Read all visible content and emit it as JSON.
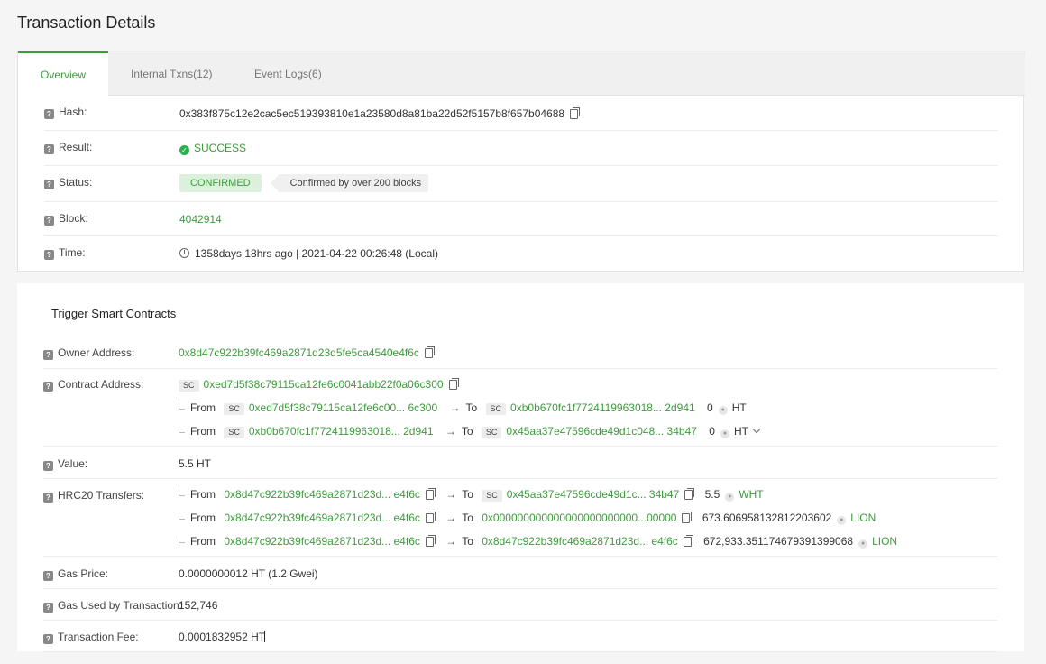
{
  "page": {
    "title": "Transaction Details"
  },
  "tabs": [
    {
      "label": "Overview",
      "active": true
    },
    {
      "label": "Internal Txns(12)",
      "active": false
    },
    {
      "label": "Event Logs(6)",
      "active": false
    }
  ],
  "overview": {
    "hash": {
      "label": "Hash:",
      "value": "0x383f875c12e2cac5ec519393810e1a23580d8a81ba22d52f5157b8f657b04688"
    },
    "result": {
      "label": "Result:",
      "value": "SUCCESS"
    },
    "status": {
      "label": "Status:",
      "badge": "CONFIRMED",
      "tooltip": "Confirmed by over 200 blocks"
    },
    "block": {
      "label": "Block:",
      "value": "4042914"
    },
    "time": {
      "label": "Time:",
      "value": "1358days 18hrs ago | 2021-04-22 00:26:48 (Local)"
    }
  },
  "contract": {
    "section_title": "Trigger Smart Contracts",
    "owner": {
      "label": "Owner Address:",
      "value": "0x8d47c922b39fc469a2871d23d5fe5ca4540e4f6c"
    },
    "contract_address": {
      "label": "Contract Address:",
      "sc_tag": "SC",
      "value": "0xed7d5f38c79115ca12fe6c0041abb22f0a06c300",
      "transfers": [
        {
          "from_word": "From",
          "from_tag": "SC",
          "from": "0xed7d5f38c79115ca12fe6c00... 6c300",
          "to_word": "To",
          "to_tag": "SC",
          "to": "0xb0b670fc1f7724119963018... 2d941",
          "amount": "0",
          "token": "HT"
        },
        {
          "from_word": "From",
          "from_tag": "SC",
          "from": "0xb0b670fc1f7724119963018... 2d941",
          "to_word": "To",
          "to_tag": "SC",
          "to": "0x45aa37e47596cde49d1c048... 34b47",
          "amount": "0",
          "token": "HT"
        }
      ]
    },
    "value": {
      "label": "Value:",
      "value": "5.5 HT"
    },
    "hrc20": {
      "label": "HRC20 Transfers:",
      "transfers": [
        {
          "from_word": "From",
          "from": "0x8d47c922b39fc469a2871d23d... e4f6c",
          "to_word": "To",
          "to_tag": "SC",
          "to": "0x45aa37e47596cde49d1c... 34b47",
          "amount": "5.5",
          "token": "WHT"
        },
        {
          "from_word": "From",
          "from": "0x8d47c922b39fc469a2871d23d... e4f6c",
          "to_word": "To",
          "to_tag": "",
          "to": "0x000000000000000000000000...00000",
          "amount": "673.606958132812203602",
          "token": "LION"
        },
        {
          "from_word": "From",
          "from": "0x8d47c922b39fc469a2871d23d... e4f6c",
          "to_word": "To",
          "to_tag": "",
          "to": "0x8d47c922b39fc469a2871d23d... e4f6c",
          "amount": "672,933.351174679391399068",
          "token": "LION"
        }
      ]
    },
    "gas_price": {
      "label": "Gas Price:",
      "value": "0.0000000012 HT (1.2 Gwei)"
    },
    "gas_used": {
      "label": "Gas Used by Transaction:",
      "value": "152,746"
    },
    "fee": {
      "label": "Transaction Fee:",
      "value": "0.0001832952 HT"
    }
  }
}
